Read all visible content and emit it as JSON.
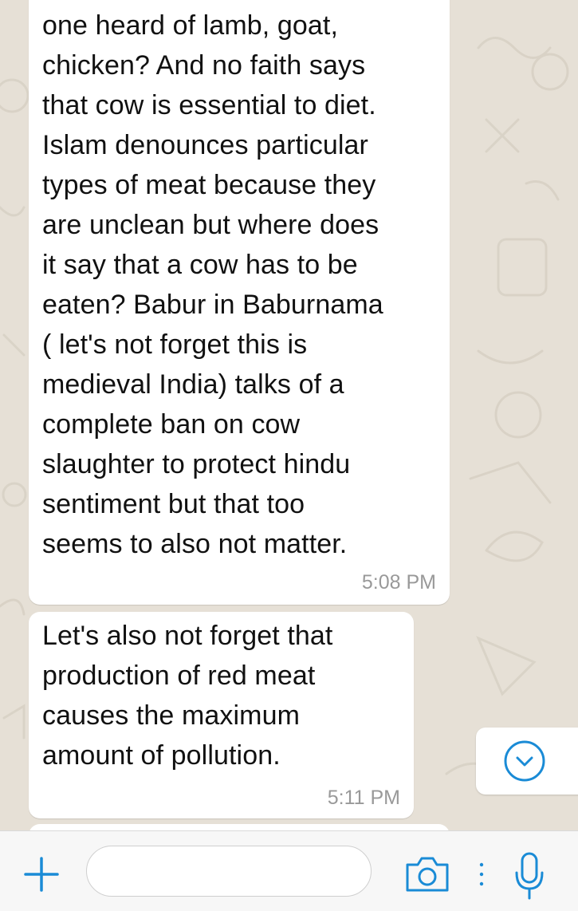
{
  "messages": [
    {
      "text": "one heard of lamb, goat,\nchicken? And no faith says\nthat cow is essential to diet.\nIslam denounces particular\ntypes of meat because they\nare unclean but where does\nit say that a cow has to be\neaten? Babur in Baburnama\n( let's not forget this is\nmedieval India) talks of a\ncomplete ban on cow\nslaughter to protect hindu\nsentiment but that too\nseems to also not matter.",
      "time": "5:08 PM"
    },
    {
      "text": "Let's also not forget that\nproduction of red meat\ncauses the maximum\namount of pollution.",
      "time": "5:11 PM"
    }
  ],
  "input_bar": {
    "message_value": "",
    "icons": {
      "attach": "plus-icon",
      "camera": "camera-icon",
      "more": "vertical-dots-icon",
      "voice": "microphone-icon"
    }
  },
  "scroll_button": {
    "icon": "chevron-down-icon"
  },
  "colors": {
    "accent": "#1a8bd6",
    "bubble": "#ffffff",
    "background": "#e6e0d6",
    "time_text": "#999999"
  }
}
